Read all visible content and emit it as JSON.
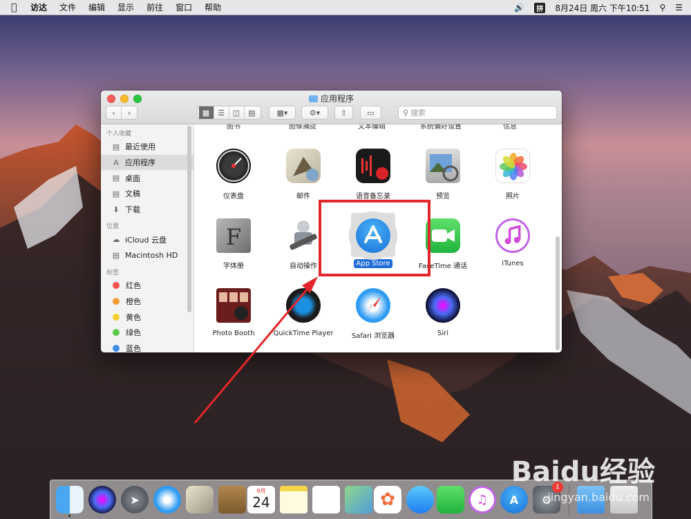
{
  "menubar": {
    "apple_icon": "apple-icon",
    "items": [
      "访达",
      "文件",
      "编辑",
      "显示",
      "前往",
      "窗口",
      "帮助"
    ],
    "volume_icon": "volume-icon",
    "input_method": "拼",
    "datetime": "8月24日 周六 下午10:51",
    "search_icon": "spotlight-icon",
    "list_icon": "notification-center-icon"
  },
  "window": {
    "title": "应用程序",
    "search_placeholder": "搜索"
  },
  "sidebar": {
    "sections": [
      {
        "heading": "个人收藏",
        "items": [
          "最近使用",
          "应用程序",
          "桌面",
          "文稿",
          "下载"
        ]
      },
      {
        "heading": "位置",
        "items": [
          "iCloud 云盘",
          "Macintosh HD"
        ]
      },
      {
        "heading": "标签",
        "items": [
          "红色",
          "橙色",
          "黄色",
          "绿色",
          "蓝色"
        ]
      }
    ],
    "tag_colors": [
      "#f04e48",
      "#f39a35",
      "#f5cd2f",
      "#5ac84a",
      "#3d8cf2"
    ]
  },
  "content": {
    "cut_row": [
      "图书",
      "图像捕捉",
      "文本编辑",
      "系统偏好设置",
      "信息"
    ],
    "rows": [
      [
        "仪表盘",
        "邮件",
        "语音备忘录",
        "预览",
        "照片"
      ],
      [
        "字体册",
        "自动操作",
        "App Store",
        "FaceTime 通话",
        "iTunes"
      ],
      [
        "Photo Booth",
        "QuickTime Player",
        "Safari 浏览器",
        "Siri"
      ]
    ],
    "selected": "App Store"
  },
  "calendar": {
    "month": "8月",
    "day": "24"
  },
  "dock_badge": "1",
  "watermark": {
    "brand": "Baidu经验",
    "url": "jingyan.baidu.com"
  }
}
